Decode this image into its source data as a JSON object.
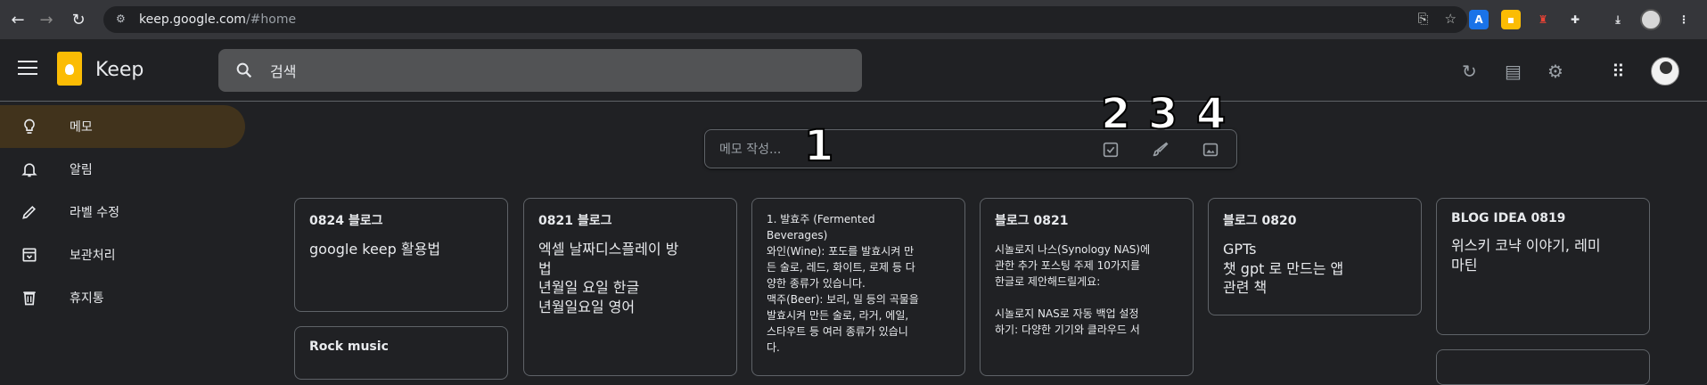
{
  "browser": {
    "url_host": "keep.google.com",
    "url_path": "/#home"
  },
  "app": {
    "title": "Keep",
    "search_placeholder": "검색"
  },
  "sidebar": {
    "items": [
      {
        "label": "메모",
        "icon": "lightbulb-icon",
        "active": true
      },
      {
        "label": "알림",
        "icon": "bell-icon",
        "active": false
      },
      {
        "label": "라벨 수정",
        "icon": "pencil-icon",
        "active": false
      },
      {
        "label": "보관처리",
        "icon": "archive-icon",
        "active": false
      },
      {
        "label": "휴지통",
        "icon": "trash-icon",
        "active": false
      }
    ]
  },
  "take_note": {
    "placeholder": "메모 작성..."
  },
  "annotations": [
    "1",
    "2",
    "3",
    "4"
  ],
  "notes": [
    {
      "title": "0824 블로그",
      "body": "google keep 활용법"
    },
    {
      "title": "0821 블로그",
      "body": "엑셀 날짜디스플레이 방\n법\n년월일 요일 한글\n년월일요일 영어"
    },
    {
      "title": "",
      "body": "1. 발효주 (Fermented\nBeverages)\n와인(Wine): 포도를 발효시켜 만\n든 술로, 레드, 화이트, 로제 등 다\n양한 종류가 있습니다.\n맥주(Beer): 보리, 밀 등의 곡물을\n발효시켜 만든 술로, 라거, 에일,\n스타우트 등 여러 종류가 있습니\n다."
    },
    {
      "title": "블로그 0821",
      "body": "시놀로지 나스(Synology NAS)에\n관한 추가 포스팅 주제 10가지를\n한글로 제안해드릴게요:\n\n시놀로지 NAS로 자동 백업 설정\n하기: 다양한 기기와 클라우드 서"
    },
    {
      "title": "블로그 0820",
      "body": "GPTs\n챗 gpt 로 만드는 앱\n관련 책"
    },
    {
      "title": "BLOG IDEA 0819",
      "body": "위스키 코냑 이야기, 레미\n마틴"
    },
    {
      "title": "Rock music",
      "body": ""
    }
  ],
  "colors": {
    "background": "#202124",
    "active_nav": "#41331c",
    "brand": "#fbbc04"
  }
}
